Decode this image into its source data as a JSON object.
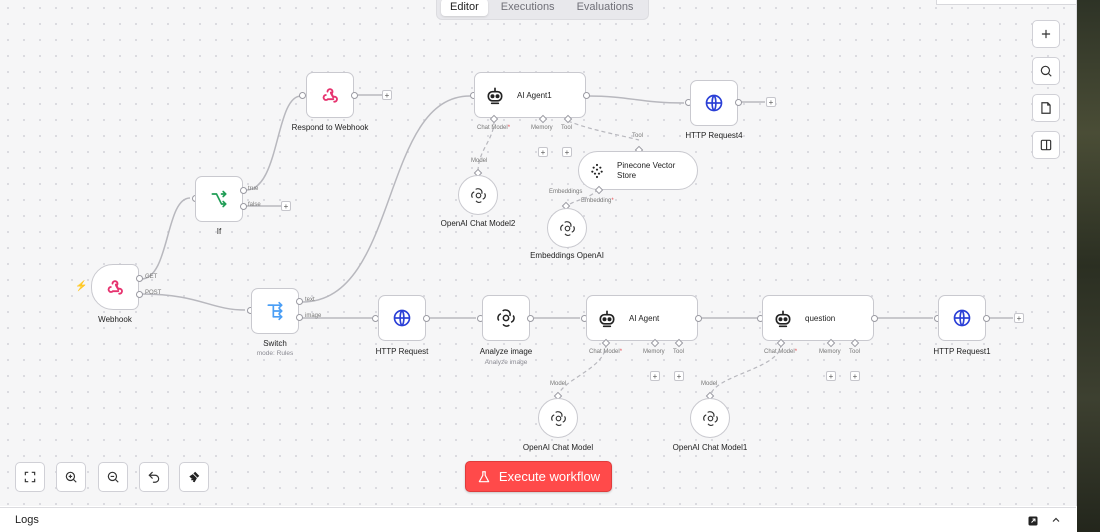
{
  "tabs": [
    {
      "label": "Editor",
      "active": true
    },
    {
      "label": "Executions",
      "active": false
    },
    {
      "label": "Evaluations",
      "active": false
    }
  ],
  "nodes": {
    "webhook": {
      "label": "Webhook",
      "outputs": [
        "GET",
        "POST"
      ]
    },
    "if": {
      "label": "If",
      "outputs": [
        "true",
        "false"
      ]
    },
    "respond": {
      "label": "Respond to Webhook"
    },
    "switch": {
      "label": "Switch",
      "sublabel": "mode: Rules",
      "outputs": [
        "text",
        "image"
      ]
    },
    "agent1": {
      "label": "AI Agent1",
      "ports": [
        "Chat Model",
        "Memory",
        "Tool"
      ]
    },
    "http4": {
      "label": "HTTP Request4"
    },
    "pinecone": {
      "label": "Pinecone Vector Store",
      "ports_top": "Tool",
      "ports_bottom": "Embeddings",
      "port_bottom2": "Embedding"
    },
    "openai2": {
      "label": "OpenAI Chat Model2",
      "port": "Model"
    },
    "embeddings": {
      "label": "Embeddings OpenAI"
    },
    "http": {
      "label": "HTTP Request"
    },
    "analyze": {
      "label": "Analyze image",
      "sublabel": "Analyze image"
    },
    "agent": {
      "label": "AI Agent",
      "ports": [
        "Chat Model",
        "Memory",
        "Tool"
      ]
    },
    "question": {
      "label": "question",
      "ports": [
        "Chat Model",
        "Memory",
        "Tool"
      ]
    },
    "http1": {
      "label": "HTTP Request1"
    },
    "openai": {
      "label": "OpenAI Chat Model",
      "port": "Model"
    },
    "openai1": {
      "label": "OpenAI Chat Model1",
      "port": "Model"
    }
  },
  "required_mark": "*",
  "execute_button": {
    "label": "Execute workflow"
  },
  "logs": {
    "label": "Logs"
  },
  "colors": {
    "accent": "#ff4a4a",
    "webhook": "#e6336f",
    "if": "#1f9d55",
    "switch": "#4a9ef5",
    "http": "#2a3fd6"
  }
}
